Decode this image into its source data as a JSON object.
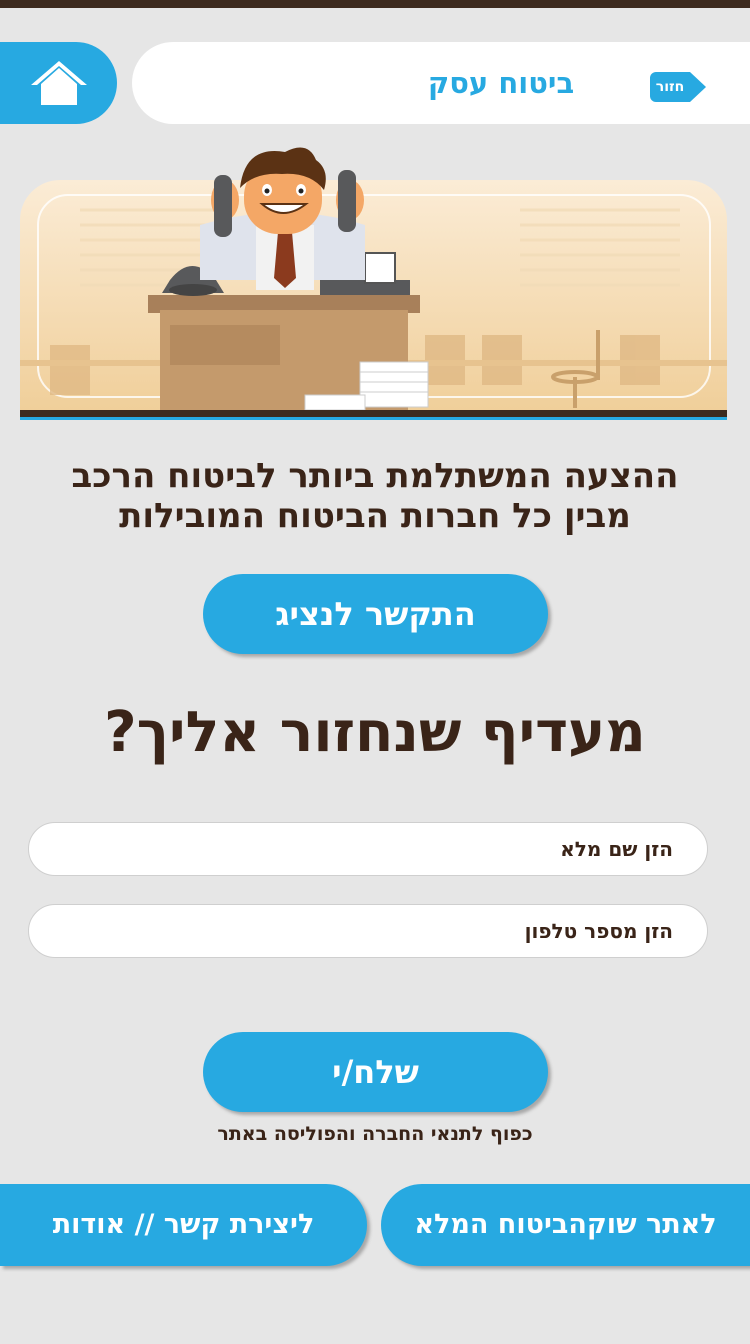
{
  "header": {
    "title": "ביטוח עסק",
    "back_label": "חזור",
    "home_icon": "home-icon"
  },
  "hero": {
    "illustration": "stressed-businessman-office"
  },
  "main": {
    "headline_line1": "ההצעה המשתלמת ביותר לביטוח הרכב",
    "headline_line2": "מבין כל חברות הביטוח המובילות",
    "call_agent_label": "התקשר לנציג",
    "question": "מעדיף שנחזור אליך?"
  },
  "form": {
    "name_placeholder": "הזן שם מלא",
    "phone_placeholder": "הזן מספר טלפון",
    "submit_label": "שלח/י",
    "terms_text": "כפוף לתנאי החברה והפוליסה באתר"
  },
  "footer": {
    "full_site_label": "לאתר שוקהביטוח המלא",
    "contact_about_label": "ליצירת קשר // אודות"
  },
  "colors": {
    "accent": "#27a9e1",
    "text": "#3a2418",
    "background": "#e6e6e6"
  }
}
